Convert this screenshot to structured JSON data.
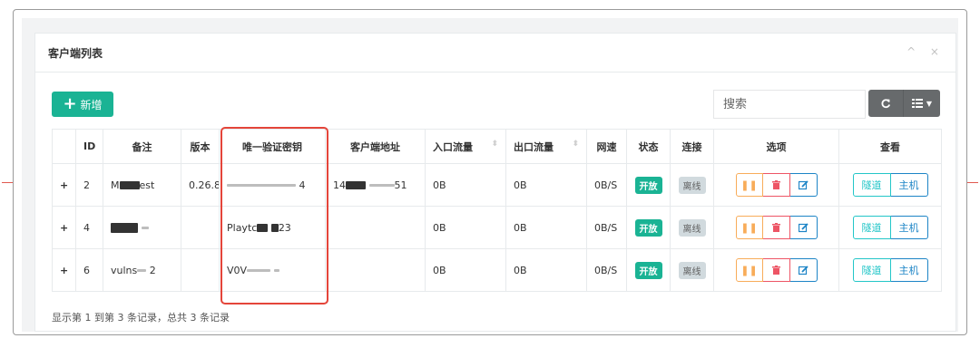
{
  "panel": {
    "title": "客户端列表",
    "tools": "^ ×"
  },
  "toolbar": {
    "add_label": "新增",
    "search_placeholder": "搜索"
  },
  "table": {
    "headers": {
      "id": "ID",
      "remark": "备注",
      "version": "版本",
      "key": "唯一验证密钥",
      "addr": "客户端地址",
      "in": "入口流量",
      "out": "出口流量",
      "speed": "网速",
      "status": "状态",
      "conn": "连接",
      "options": "选项",
      "view": "查看"
    },
    "rows": [
      {
        "id": "2",
        "remark_a": "M",
        "remark_b": "est",
        "version": "0.26.8",
        "key_a": "",
        "key_b": "4",
        "addr_a": "14",
        "addr_b": "51",
        "in": "0B",
        "out": "0B",
        "speed": "0B/S",
        "status": "开放",
        "conn": "离线"
      },
      {
        "id": "4",
        "remark_a": "",
        "remark_b": "",
        "version": "",
        "key_a": "Playtc",
        "key_b": "23",
        "addr_a": "",
        "addr_b": "",
        "in": "0B",
        "out": "0B",
        "speed": "0B/S",
        "status": "开放",
        "conn": "离线"
      },
      {
        "id": "6",
        "remark_a": "vulns",
        "remark_b": "2",
        "version": "",
        "key_a": "V0V",
        "key_b": "",
        "addr_a": "",
        "addr_b": "",
        "in": "0B",
        "out": "0B",
        "speed": "0B/S",
        "status": "开放",
        "conn": "离线"
      }
    ],
    "buttons": {
      "tunnel": "隧道",
      "host": "主机"
    }
  },
  "footer": {
    "summary": "显示第 1 到第 3 条记录，总共 3 条记录"
  },
  "icons": {
    "expand": "plus-icon",
    "pause": "pause-icon",
    "delete": "trash-icon",
    "edit": "edit-icon",
    "refresh": "refresh-icon",
    "columns": "columns-icon"
  },
  "colors": {
    "primary": "#1ab394",
    "warning": "#f8ac59",
    "danger": "#ed5565",
    "info": "#1c84c6",
    "tunnel": "#23c6c8",
    "highlight": "#e4453a"
  }
}
